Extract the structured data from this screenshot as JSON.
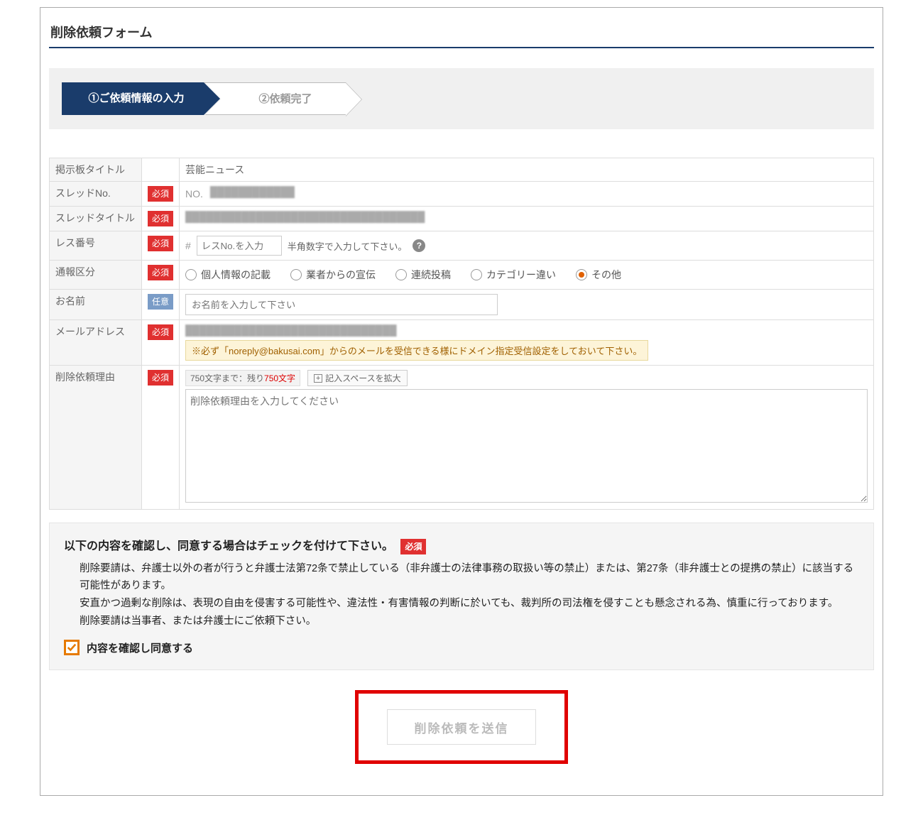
{
  "page_title": "削除依頼フォーム",
  "steps": {
    "step1": "①ご依頼情報の入力",
    "step2": "②依頼完了"
  },
  "badges": {
    "required": "必須",
    "optional": "任意"
  },
  "fields": {
    "board_title": {
      "label": "掲示板タイトル",
      "value": "芸能ニュース"
    },
    "thread_no": {
      "label": "スレッドNo.",
      "prefix": "NO.",
      "value_redacted": "████████████"
    },
    "thread_title": {
      "label": "スレッドタイトル",
      "value_redacted": "██████████████████████████████████"
    },
    "res_no": {
      "label": "レス番号",
      "hash": "#",
      "placeholder": "レスNo.を入力",
      "hint": "半角数字で入力して下さい。"
    },
    "report_type": {
      "label": "通報区分",
      "options": [
        "個人情報の記載",
        "業者からの宣伝",
        "連続投稿",
        "カテゴリー違い",
        "その他"
      ],
      "selected_index": 4
    },
    "name": {
      "label": "お名前",
      "placeholder": "お名前を入力して下さい"
    },
    "email": {
      "label": "メールアドレス",
      "value_redacted": "██████████████████████████████",
      "note": "※必ず「noreply@bakusai.com」からのメールを受信できる様にドメイン指定受信設定をしておいて下さい。"
    },
    "reason": {
      "label": "削除依頼理由",
      "counter_prefix": "750文字まで：残り",
      "counter_remain": "750文字",
      "expand": "記入スペースを拡大",
      "placeholder": "削除依頼理由を入力してください"
    }
  },
  "consent": {
    "title": "以下の内容を確認し、同意する場合はチェックを付けて下さい。",
    "body1": "削除要請は、弁護士以外の者が行うと弁護士法第72条で禁止している（非弁護士の法律事務の取扱い等の禁止）または、第27条（非弁護士との提携の禁止）に該当する可能性があります。",
    "body2": "安直かつ過剰な削除は、表現の自由を侵害する可能性や、違法性・有害情報の判断に於いても、裁判所の司法権を侵すことも懸念される為、慎重に行っております。",
    "body3": "削除要請は当事者、または弁護士にご依頼下さい。",
    "checkbox_label": "内容を確認し同意する"
  },
  "submit_label": "削除依頼を送信"
}
